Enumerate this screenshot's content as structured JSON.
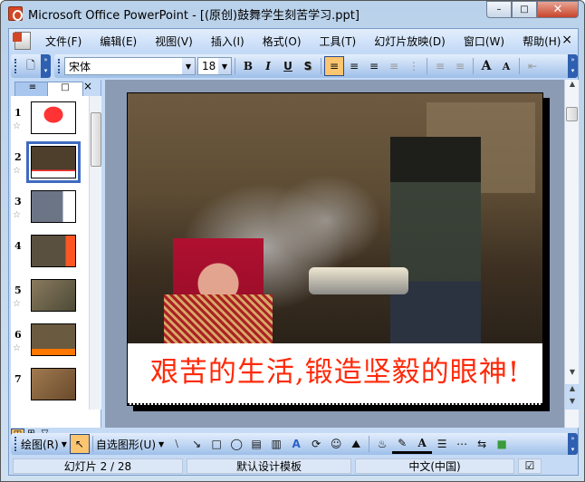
{
  "window": {
    "title": "Microsoft Office PowerPoint - [(原创)鼓舞学生刻苦学习.ppt]",
    "minimize": "–",
    "maximize": "□",
    "close": "✕"
  },
  "menu": {
    "items": [
      "文件(F)",
      "编辑(E)",
      "视图(V)",
      "插入(I)",
      "格式(O)",
      "工具(T)",
      "幻灯片放映(D)",
      "窗口(W)",
      "帮助(H)"
    ],
    "close": "×"
  },
  "format": {
    "font": "宋体",
    "size": "18",
    "bold": "B",
    "italic": "I",
    "underline": "U",
    "shadow": "S",
    "grow": "A",
    "shrink": "A"
  },
  "pane": {
    "outline_tab": "≡",
    "slides_tab": "□",
    "close": "×",
    "slides": [
      {
        "num": "1",
        "star": "☆"
      },
      {
        "num": "2",
        "star": "☆"
      },
      {
        "num": "3",
        "star": "☆"
      },
      {
        "num": "4",
        "star": ""
      },
      {
        "num": "5",
        "star": "☆"
      },
      {
        "num": "6",
        "star": "☆"
      },
      {
        "num": "7",
        "star": ""
      }
    ]
  },
  "slide": {
    "caption": "艰苦的生活,锻造坚毅的眼神!"
  },
  "drawing": {
    "draw_label": "绘图(R)",
    "autoshapes_label": "自选图形(U)"
  },
  "status": {
    "slide": "幻灯片 2 / 28",
    "template": "默认设计模板",
    "language": "中文(中国)"
  }
}
